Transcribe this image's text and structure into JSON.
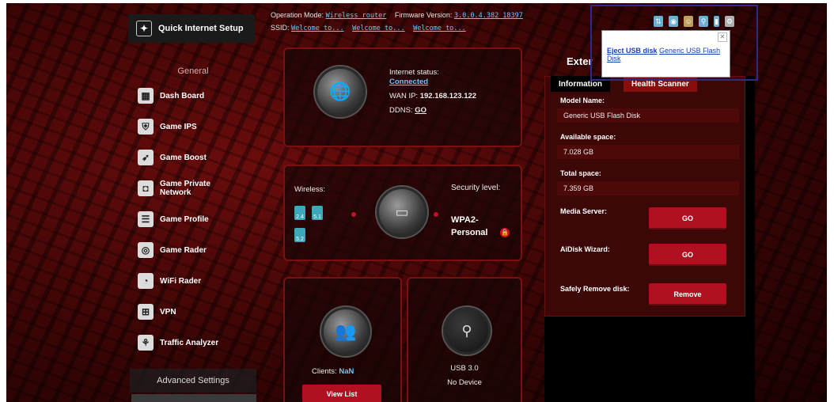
{
  "topbar": {
    "qis_label": "Quick Internet Setup",
    "op_mode_label": "Operation Mode:",
    "op_mode_value": "Wireless router",
    "firmware_label": "Firmware Version:",
    "firmware_value": "3.0.0.4.382_18397",
    "ssid_label": "SSID:",
    "ssids": [
      "Welcome_to...",
      "Welcome_to...",
      "Welcome_to..."
    ],
    "icons": [
      "network-icon",
      "wireless-icon",
      "user-icon",
      "usb-status-icon",
      "usb-drive-icon",
      "settings-icon"
    ]
  },
  "sidebar": {
    "general_heading": "General",
    "items": [
      {
        "label": "Dash Board",
        "icon": "dashboard-icon",
        "glyph": "▦"
      },
      {
        "label": "Game IPS",
        "icon": "shield-icon",
        "glyph": "⛨"
      },
      {
        "label": "Game Boost",
        "icon": "rocket-icon",
        "glyph": "➶"
      },
      {
        "label": "Game Private Network",
        "icon": "network-icon",
        "glyph": "◘"
      },
      {
        "label": "Game Profile",
        "icon": "profile-icon",
        "glyph": "☰"
      },
      {
        "label": "Game Rader",
        "icon": "radar-icon",
        "glyph": "◎"
      },
      {
        "label": "WiFi Rader",
        "icon": "wifi-radar-icon",
        "glyph": "◔"
      },
      {
        "label": "VPN",
        "icon": "vpn-icon",
        "glyph": "⊞"
      },
      {
        "label": "Traffic Analyzer",
        "icon": "traffic-icon",
        "glyph": "⚘"
      }
    ],
    "advanced_heading": "Advanced Settings"
  },
  "internet": {
    "status_label": "Internet status:",
    "status_value": "Connected",
    "wan_label": "WAN IP:",
    "wan_value": "192.168.123.122",
    "ddns_label": "DDNS:",
    "ddns_value": "GO"
  },
  "wireless": {
    "label": "Wireless:",
    "bands": [
      "2.4",
      "5.1",
      "5.2"
    ],
    "security_label": "Security level:",
    "security_value": "WPA2-Personal"
  },
  "clients": {
    "label": "Clients:",
    "value": "NaN",
    "button": "View List"
  },
  "usb": {
    "label": "USB 3.0",
    "status": "No Device"
  },
  "external": {
    "title": "Exter",
    "tabs": [
      "Information",
      "Health Scanner"
    ],
    "model_label": "Model Name:",
    "model_value": "Generic USB Flash Disk",
    "available_label": "Available space:",
    "available_value": "7.028 GB",
    "total_label": "Total space:",
    "total_value": "7.359 GB",
    "media_label": "Media Server:",
    "media_button": "GO",
    "aidisk_label": "AiDisk Wizard:",
    "aidisk_button": "GO",
    "remove_label": "Safely Remove disk:",
    "remove_button": "Remove"
  },
  "popup": {
    "link_text": "Eject USB disk",
    "detail": "Generic USB Flash Disk"
  },
  "colors": {
    "accent": "#b01020",
    "link": "#6ec6ff",
    "panel_border": "#7a1010"
  }
}
